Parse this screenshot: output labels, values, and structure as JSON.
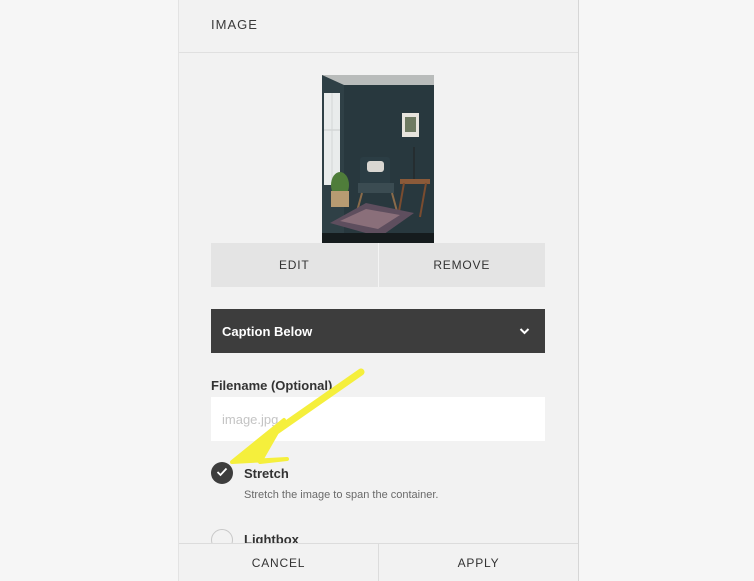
{
  "panel": {
    "title": "IMAGE",
    "image_buttons": {
      "edit": "EDIT",
      "remove": "REMOVE"
    },
    "layout_select": {
      "selected": "Caption Below",
      "icon": "chevron-down-icon"
    },
    "filename": {
      "label": "Filename (Optional)",
      "placeholder": "image.jpg",
      "value": ""
    },
    "options": [
      {
        "label": "Stretch",
        "description": "Stretch the image to span the container.",
        "checked": true
      },
      {
        "label": "Lightbox",
        "checked": false
      }
    ],
    "footer": {
      "cancel": "CANCEL",
      "apply": "APPLY"
    }
  },
  "colors": {
    "accent_dark": "#3d3d3d",
    "arrow": "#f5ef3c"
  }
}
